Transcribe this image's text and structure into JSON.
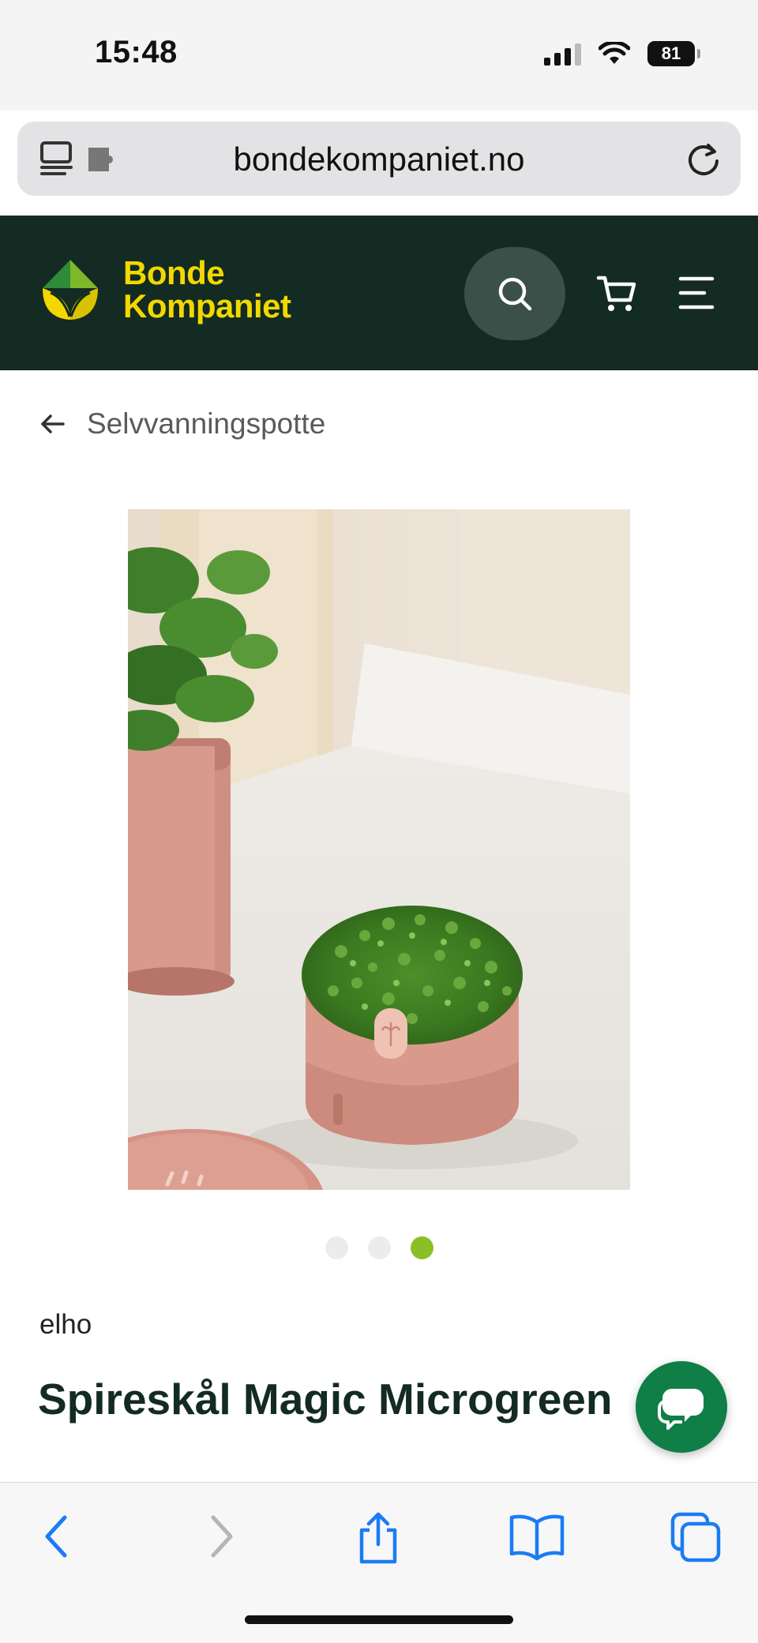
{
  "status_bar": {
    "time": "15:48",
    "battery": "81"
  },
  "browser": {
    "url": "bondekompaniet.no"
  },
  "header": {
    "logo_line1": "Bonde",
    "logo_line2": "Kompaniet",
    "icons": [
      "search-icon",
      "cart-icon",
      "menu-icon"
    ]
  },
  "breadcrumb": {
    "label": "Selvvanningspotte"
  },
  "carousel": {
    "slides": 3,
    "active_index": 2
  },
  "product": {
    "brand": "elho",
    "title": "Spireskål Magic Microgreen"
  },
  "toolbar": {
    "icons": [
      "back-icon",
      "forward-icon",
      "share-icon",
      "bookmarks-icon",
      "tabs-icon"
    ]
  },
  "colors": {
    "header_bg": "#132b22",
    "logo_yellow": "#f2d800",
    "accent_green": "#8cbf26",
    "chat_green": "#0f7f47",
    "ios_blue": "#1a7cf5"
  }
}
